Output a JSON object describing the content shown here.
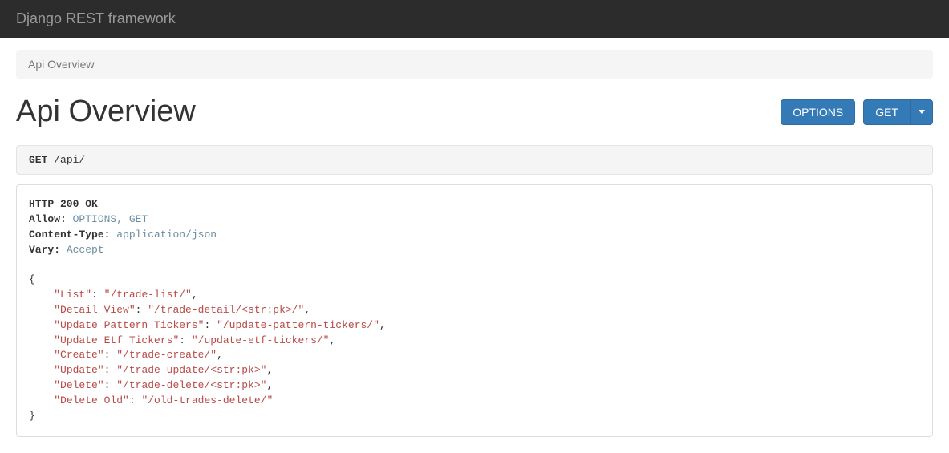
{
  "navbar": {
    "brand": "Django REST framework"
  },
  "breadcrumb": "Api Overview",
  "page_title": "Api Overview",
  "buttons": {
    "options": "OPTIONS",
    "get": "GET"
  },
  "request": {
    "method": "GET",
    "path": "/api/"
  },
  "response": {
    "status_line": "HTTP 200 OK",
    "headers": [
      {
        "k": "Allow",
        "v": "OPTIONS, GET"
      },
      {
        "k": "Content-Type",
        "v": "application/json"
      },
      {
        "k": "Vary",
        "v": "Accept"
      }
    ],
    "body": [
      {
        "k": "List",
        "v": "/trade-list/"
      },
      {
        "k": "Detail View",
        "v": "/trade-detail/<str:pk>/"
      },
      {
        "k": "Update Pattern Tickers",
        "v": "/update-pattern-tickers/"
      },
      {
        "k": "Update Etf Tickers",
        "v": "/update-etf-tickers/"
      },
      {
        "k": "Create",
        "v": "/trade-create/"
      },
      {
        "k": "Update",
        "v": "/trade-update/<str:pk>"
      },
      {
        "k": "Delete",
        "v": "/trade-delete/<str:pk>"
      },
      {
        "k": "Delete Old",
        "v": "/old-trades-delete/"
      }
    ]
  }
}
